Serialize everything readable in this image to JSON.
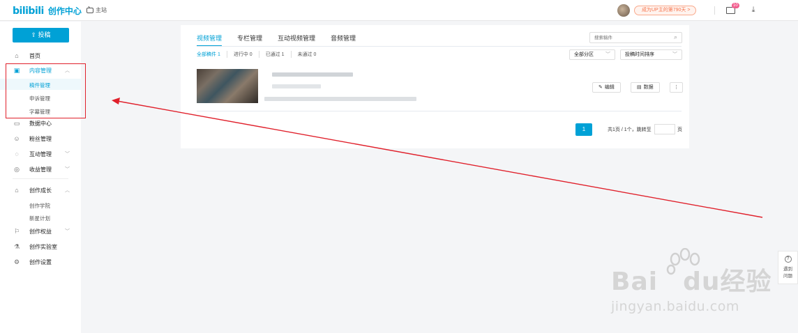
{
  "header": {
    "logo_mark": "bilibili",
    "logo_title": "创作中心",
    "home_link": "主站",
    "up_badge": "成为UP主的第790天 >",
    "mail_count": "10"
  },
  "sidebar": {
    "upload_label": "投稿",
    "items": [
      {
        "icon": "home-icon",
        "label": "首页"
      },
      {
        "icon": "content-icon",
        "label": "内容管理",
        "expanded": true,
        "active": true
      },
      {
        "icon": "data-icon",
        "label": "数据中心"
      },
      {
        "icon": "fans-icon",
        "label": "粉丝管理"
      },
      {
        "icon": "interact-icon",
        "label": "互动管理"
      },
      {
        "icon": "income-icon",
        "label": "收益管理"
      },
      {
        "icon": "growth-icon",
        "label": "创作成长"
      },
      {
        "icon": "rights-icon",
        "label": "创作权益"
      },
      {
        "icon": "lab-icon",
        "label": "创作实验室"
      },
      {
        "icon": "settings-icon",
        "label": "创作设置"
      }
    ],
    "content_sub": [
      "稿件管理",
      "申诉管理",
      "字幕管理"
    ],
    "growth_sub": [
      "创作学院",
      "新星计划"
    ]
  },
  "main": {
    "tabs": [
      "视频管理",
      "专栏管理",
      "互动视频管理",
      "音频管理"
    ],
    "search_placeholder": "搜索稿件",
    "filters": [
      "全部稿件 1",
      "进行中 0",
      "已通过 1",
      "未通过 0"
    ],
    "category_select": "全部分区",
    "sort_select": "投稿时间排序",
    "actions": {
      "edit": "编辑",
      "data": "数据",
      "more": "⋮"
    },
    "pagination": {
      "current": "1",
      "info": "共1页 / 1个，跳转至",
      "suffix": "页"
    }
  },
  "help": {
    "label_line1": "遇到",
    "label_line2": "问题"
  },
  "watermark": {
    "main": "Bai",
    "du": "du",
    "cn": "经验",
    "url": "jingyan.baidu.com"
  },
  "colors": {
    "accent": "#00a1d6",
    "annotation": "#e0202b",
    "badge": "#f6734b"
  }
}
